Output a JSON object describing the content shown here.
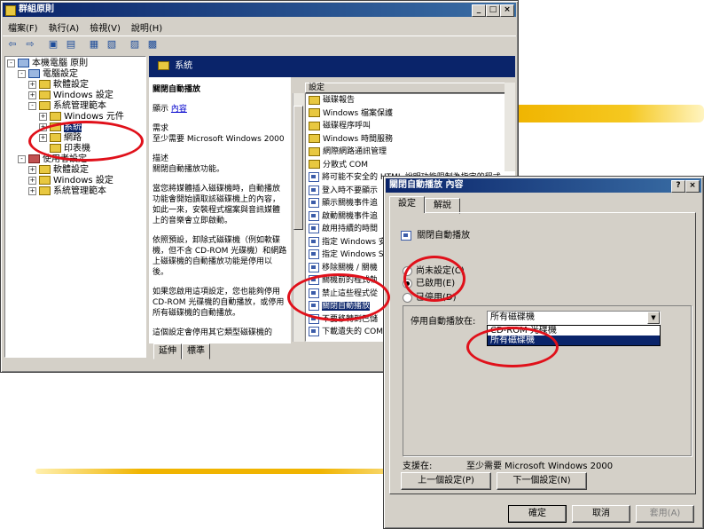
{
  "gpedit": {
    "title": "群組原則",
    "menu": [
      "檔案(F)",
      "執行(A)",
      "檢視(V)",
      "說明(H)"
    ],
    "tree": [
      {
        "label": "本機電腦 原則",
        "level": 0,
        "expander": "-",
        "icon": "computer"
      },
      {
        "label": "電腦設定",
        "level": 1,
        "expander": "-",
        "icon": "computer"
      },
      {
        "label": "軟體設定",
        "level": 2,
        "expander": "+",
        "icon": "folder"
      },
      {
        "label": "Windows 設定",
        "level": 2,
        "expander": "+",
        "icon": "folder"
      },
      {
        "label": "系統管理範本",
        "level": 2,
        "expander": "-",
        "icon": "folder"
      },
      {
        "label": "Windows 元件",
        "level": 3,
        "expander": "+",
        "icon": "folder"
      },
      {
        "label": "系統",
        "level": 3,
        "expander": "+",
        "icon": "folder",
        "selected": true
      },
      {
        "label": "網路",
        "level": 3,
        "expander": "+",
        "icon": "folder"
      },
      {
        "label": "印表機",
        "level": 3,
        "expander": "",
        "icon": "folder"
      },
      {
        "label": "使用者設定",
        "level": 1,
        "expander": "-",
        "icon": "user"
      },
      {
        "label": "軟體設定",
        "level": 2,
        "expander": "+",
        "icon": "folder"
      },
      {
        "label": "Windows 設定",
        "level": 2,
        "expander": "+",
        "icon": "folder"
      },
      {
        "label": "系統管理範本",
        "level": 2,
        "expander": "+",
        "icon": "folder"
      }
    ],
    "header": "系統",
    "desc_title": "關閉自動播放",
    "desc_show": "顯示",
    "desc_link": "內容",
    "desc_req_label": "需求",
    "desc_req": "至少需要 Microsoft Windows 2000",
    "desc_label": "描述",
    "desc_lines": [
      "關閉自動播放功能。",
      "當您將媒體插入磁碟機時，自動播放功能會開始讀取該磁碟機上的內容，如此一來，安裝程式檔案與音訊媒體上的音樂會立即啟動。",
      "依照預設，卸除式磁碟機（例如軟碟機，但不含 CD-ROM 光碟機）和網路上磁碟機的自動播放功能是停用以後。",
      "如果您啟用這項設定，您也能夠停用 CD-ROM 光碟機的自動播放，或停用所有磁碟機的自動播放。",
      "這個設定會停用其它類型磁碟機的"
    ],
    "list_header": "設定",
    "list_items": [
      {
        "label": "磁碟報告",
        "icon": "folder"
      },
      {
        "label": "Windows 檔案保護",
        "icon": "folder"
      },
      {
        "label": "磁碟程序呼叫",
        "icon": "folder"
      },
      {
        "label": "Windows 時間服務",
        "icon": "folder"
      },
      {
        "label": "網際網路通訊管理",
        "icon": "folder"
      },
      {
        "label": "分散式 COM",
        "icon": "folder"
      },
      {
        "label": "將可能不安全的 HTML 說明功能限制為指定的程式",
        "icon": "policy"
      },
      {
        "label": "登入時不要顯示",
        "icon": "policy"
      },
      {
        "label": "顯示關機事件追",
        "icon": "policy"
      },
      {
        "label": "啟動關機事件追",
        "icon": "policy"
      },
      {
        "label": "啟用持續的時間",
        "icon": "policy"
      },
      {
        "label": "指定 Windows 安",
        "icon": "policy"
      },
      {
        "label": "指定 Windows Se",
        "icon": "policy"
      },
      {
        "label": "移除關機 / 關機",
        "icon": "policy"
      },
      {
        "label": "關機前的程式執",
        "icon": "policy"
      },
      {
        "label": "禁止這些程式從",
        "icon": "policy"
      },
      {
        "label": "關閉自動播放",
        "icon": "policy",
        "selected": true
      },
      {
        "label": "不要移轉到已儲",
        "icon": "policy"
      },
      {
        "label": "下載遺失的 COM",
        "icon": "policy"
      }
    ],
    "tabs": [
      "延伸",
      "標準"
    ]
  },
  "dialog": {
    "title": "關閉自動播放 內容",
    "help_btn": "?",
    "close_btn": "×",
    "tabs": [
      "設定",
      "解說"
    ],
    "setting_name": "關閉自動播放",
    "radios": [
      "尚未設定(C)",
      "已啟用(E)",
      "已停用(D)"
    ],
    "selected_radio": 1,
    "combo_label": "停用自動播放在:",
    "combo_value": "所有磁碟機",
    "dropdown_options": [
      "CD-ROM 光碟機",
      "所有磁碟機"
    ],
    "dropdown_selected": 1,
    "support_label": "支援在:",
    "support_value": "至少需要 Microsoft Windows 2000",
    "prev_btn": "上一個設定(P)",
    "next_btn": "下一個設定(N)",
    "ok_btn": "確定",
    "cancel_btn": "取消",
    "apply_btn": "套用(A)"
  },
  "colors": {
    "title_bar": "#0a246a",
    "highlight_circle": "#e0101a",
    "stroke_yellow": "#f0b400"
  }
}
